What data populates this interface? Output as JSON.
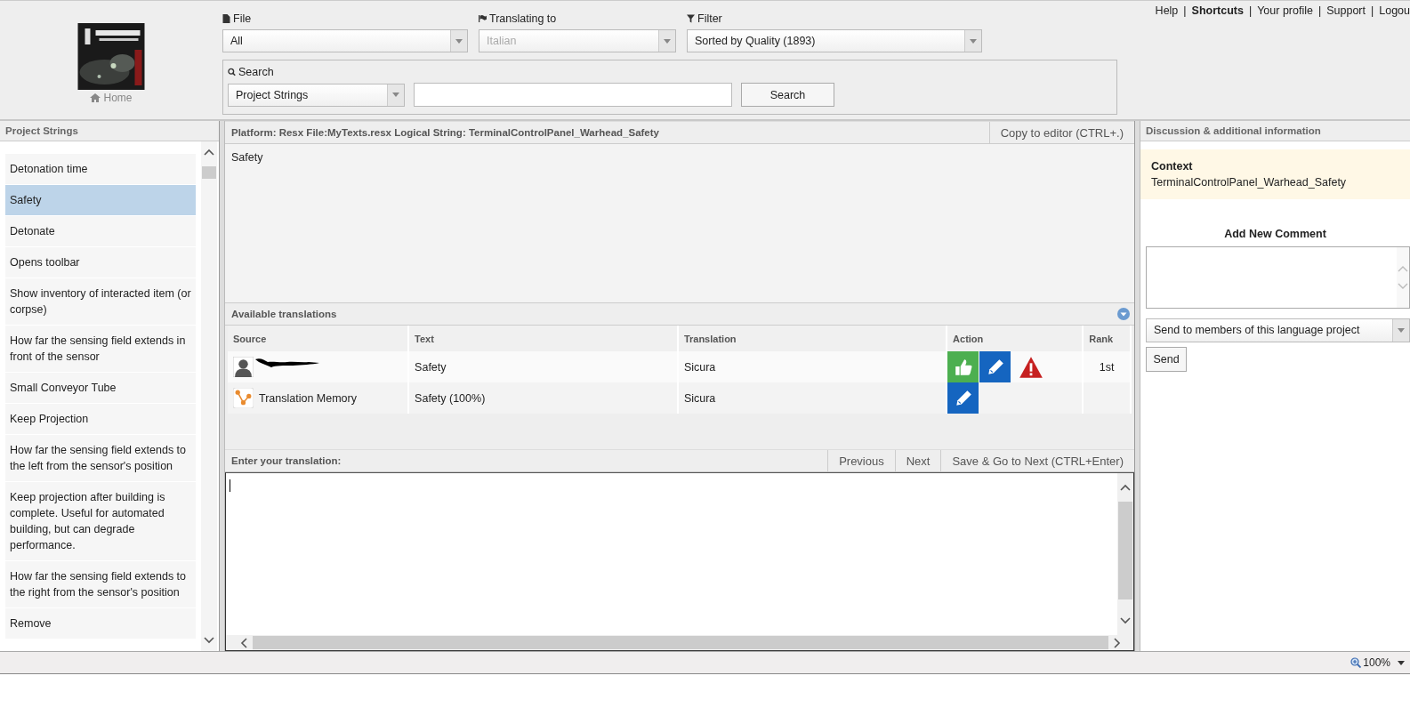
{
  "header": {
    "home_label": "Home",
    "file": {
      "label": "File",
      "value": "All",
      "disabled": false
    },
    "language": {
      "label": "Translating to",
      "value": "Italian",
      "disabled": true
    },
    "filter": {
      "label": "Filter",
      "value": "Sorted by Quality (1893)",
      "disabled": false
    },
    "search": {
      "label": "Search",
      "scope": "Project Strings",
      "button": "Search"
    },
    "links": [
      {
        "label": "Help",
        "bold": false
      },
      {
        "label": "Shortcuts",
        "bold": true
      },
      {
        "label": "Your profile",
        "bold": false
      },
      {
        "label": "Support",
        "bold": false
      },
      {
        "label": "Logou",
        "bold": false
      }
    ],
    "separator": "|"
  },
  "strings_panel": {
    "title": "Project Strings",
    "items": [
      {
        "text": "Detonation time",
        "selected": false
      },
      {
        "text": "Safety",
        "selected": true
      },
      {
        "text": "Detonate",
        "selected": false
      },
      {
        "text": "Opens toolbar",
        "selected": false
      },
      {
        "text": "Show inventory of interacted item (or corpse)",
        "selected": false
      },
      {
        "text": "How far the sensing field extends in front of the sensor",
        "selected": false
      },
      {
        "text": "Small Conveyor Tube",
        "selected": false
      },
      {
        "text": "Keep Projection",
        "selected": false
      },
      {
        "text": "How far the sensing field extends to the left from the sensor's position",
        "selected": false
      },
      {
        "text": "Keep projection after building is complete. Useful for automated building, but can degrade performance.",
        "selected": false
      },
      {
        "text": "How far the sensing field extends to the right from the sensor's position",
        "selected": false
      },
      {
        "text": "Remove",
        "selected": false
      }
    ]
  },
  "editor": {
    "info": "Platform: Resx File:MyTexts.resx Logical String: TerminalControlPanel_Warhead_Safety",
    "copy_button": "Copy to editor (CTRL+.)",
    "source_text": "Safety",
    "translations": {
      "title": "Available translations",
      "columns": [
        "Source",
        "Text",
        "Translation",
        "Action",
        "Rank"
      ],
      "rows": [
        {
          "kind": "user",
          "text": "Safety",
          "translation": "Sicura",
          "actions": [
            {
              "kind": "approve"
            },
            {
              "kind": "edit"
            },
            {
              "kind": "flag"
            }
          ],
          "rank": "1st"
        },
        {
          "kind": "memory",
          "source": "Translation Memory",
          "text": "Safety (100%)",
          "translation": "Sicura",
          "actions": [
            {
              "kind": "edit"
            }
          ]
        }
      ]
    },
    "input": {
      "label": "Enter your translation:",
      "buttons": [
        "Previous",
        "Next",
        "Save & Go to Next (CTRL+Enter)"
      ]
    }
  },
  "discussion": {
    "title": "Discussion & additional information",
    "context_label": "Context",
    "context_value": "TerminalControlPanel_Warhead_Safety",
    "comment_title": "Add New Comment",
    "recipients": "Send to members of this language project",
    "send": "Send"
  },
  "status_bar": {
    "zoom": "100%"
  }
}
